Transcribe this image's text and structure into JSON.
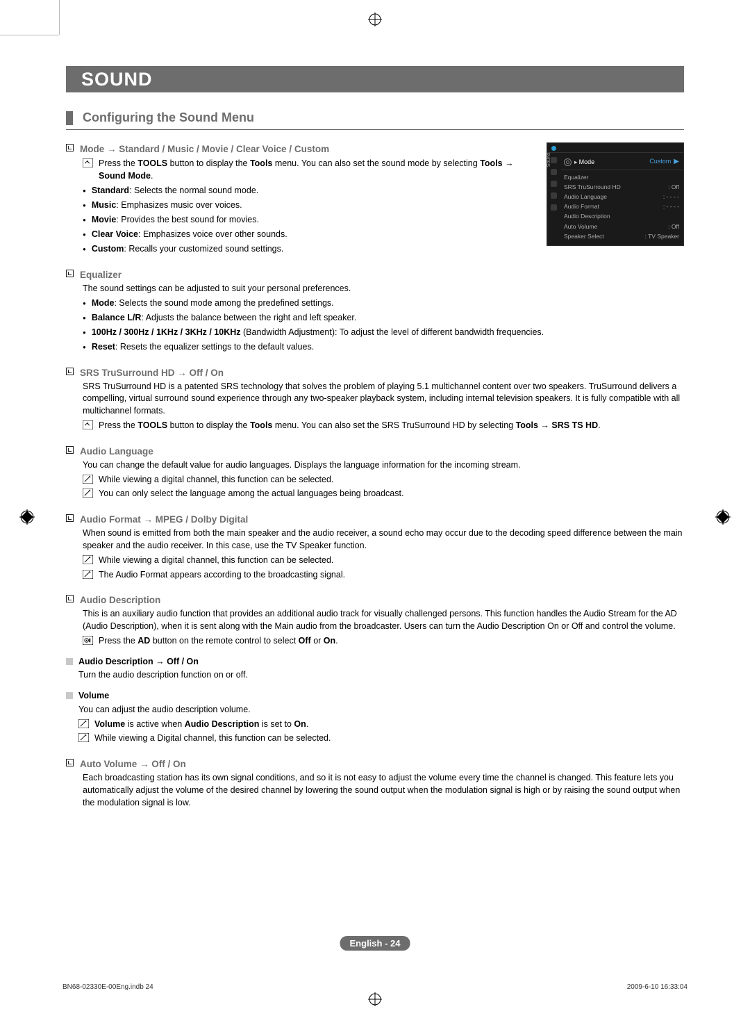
{
  "banner": "SOUND",
  "subheading": "Configuring the Sound Menu",
  "sections": {
    "mode": {
      "title": "Mode → Standard / Music / Movie / Clear Voice / Custom",
      "tool_line_a": "Press the ",
      "tool_line_b": "TOOLS",
      "tool_line_c": " button to display the ",
      "tool_line_d": "Tools",
      "tool_line_e": " menu. You can also set the sound mode by selecting ",
      "tool_line_f": "Tools → Sound Mode",
      "tool_line_g": ".",
      "items": [
        {
          "b": "Standard",
          "t": ": Selects the normal sound mode."
        },
        {
          "b": "Music",
          "t": ": Emphasizes music over voices."
        },
        {
          "b": "Movie",
          "t": ": Provides the best sound for movies."
        },
        {
          "b": "Clear Voice",
          "t": ": Emphasizes voice over other sounds."
        },
        {
          "b": "Custom",
          "t": ": Recalls your customized sound settings."
        }
      ]
    },
    "equalizer": {
      "title": "Equalizer",
      "intro": "The sound settings can be adjusted to suit your personal preferences.",
      "items": [
        {
          "b": "Mode",
          "t": ": Selects the sound mode among the predefined settings."
        },
        {
          "b": "Balance L/R",
          "t": ": Adjusts the balance between the right and left speaker."
        },
        {
          "b": "100Hz / 300Hz / 1KHz / 3KHz / 10KHz",
          "t": " (Bandwidth Adjustment): To adjust the level of different bandwidth frequencies."
        },
        {
          "b": "Reset",
          "t": ": Resets the equalizer settings to the default values."
        }
      ]
    },
    "srs": {
      "title": "SRS TruSurround HD → Off / On",
      "para": "SRS TruSurround HD is a patented SRS technology that solves the problem of playing 5.1 multichannel content over two speakers. TruSurround delivers a compelling, virtual surround sound experience through any two-speaker playback system, including internal television speakers. It is fully compatible with all multichannel formats.",
      "tool_a": "Press the ",
      "tool_b": "TOOLS",
      "tool_c": " button to display the ",
      "tool_d": "Tools",
      "tool_e": " menu. You can also set the SRS TruSurround HD by selecting ",
      "tool_f": "Tools → SRS TS HD",
      "tool_g": "."
    },
    "audiolang": {
      "title": "Audio Language",
      "para": "You can change the default value for audio languages. Displays the language information for the incoming stream.",
      "notes": [
        "While viewing a digital channel, this function can be selected.",
        "You can only select the language among the actual languages being broadcast."
      ]
    },
    "audiofmt": {
      "title": "Audio Format → MPEG / Dolby Digital",
      "para": "When sound is emitted from both the main speaker and the audio receiver, a sound echo may occur due to the decoding speed difference between the main speaker and the audio receiver. In this case, use the TV Speaker function.",
      "notes": [
        "While viewing a digital channel, this function can be selected.",
        "The Audio Format appears according to the broadcasting signal."
      ]
    },
    "audiodesc": {
      "title": "Audio Description",
      "para": "This is an auxiliary audio function that provides an additional audio track for visually challenged persons. This function handles the Audio Stream for the AD (Audio Description), when it is sent along with the Main audio from the broadcaster. Users can turn the Audio Description On or Off and control the volume.",
      "remote_a": "Press the ",
      "remote_b": "AD",
      "remote_c": " button on the remote control to select ",
      "remote_d": "Off",
      "remote_e": " or ",
      "remote_f": "On",
      "remote_g": ".",
      "sub_onoff": {
        "title": "Audio Description → Off / On",
        "body": "Turn the audio description function on or off."
      },
      "sub_vol": {
        "title": "Volume",
        "body": "You can adjust the audio description volume.",
        "note1a": "Volume",
        "note1b": " is active when ",
        "note1c": "Audio Description",
        "note1d": " is set to ",
        "note1e": "On",
        "note1f": ".",
        "note2": "While viewing a Digital channel, this function can be selected."
      }
    },
    "autovol": {
      "title": "Auto Volume → Off / On",
      "para": "Each broadcasting station has its own signal conditions, and so it is not easy to adjust the volume every time the channel is changed. This feature lets you automatically adjust the volume of the desired channel by lowering the sound output when the modulation signal is high or by raising the sound output when the modulation signal is low."
    }
  },
  "osd": {
    "side_label": "Sound",
    "header": {
      "label": "Mode",
      "value": "Custom"
    },
    "rows": [
      {
        "label": "Equalizer",
        "value": ""
      },
      {
        "label": "SRS TruSurround HD",
        "value": ": Off"
      },
      {
        "label": "Audio Language",
        "value": ": - - - -"
      },
      {
        "label": "Audio Format",
        "value": ": - - - -"
      },
      {
        "label": "Audio Description",
        "value": ""
      },
      {
        "label": "Auto Volume",
        "value": ": Off"
      },
      {
        "label": "Speaker Select",
        "value": ": TV Speaker"
      }
    ]
  },
  "footer": {
    "center": "English - 24",
    "left": "BN68-02330E-00Eng.indb   24",
    "right": "2009-6-10   16:33:04"
  }
}
